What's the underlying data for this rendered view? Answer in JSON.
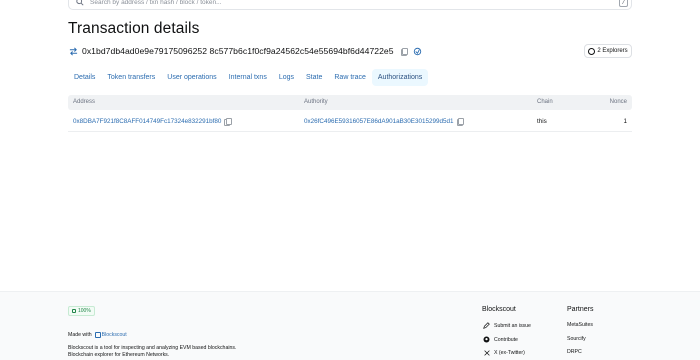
{
  "search": {
    "placeholder": "Search by address / txn hash / block / token...",
    "shortcut": "/"
  },
  "page": {
    "title": "Transaction details"
  },
  "tx": {
    "hash": "0x1bd7db4ad0e9e79175096252 8c577b6c1f0cf9a24562c54e55694bf6d44722e5"
  },
  "explorers": {
    "label": "2 Explorers"
  },
  "tabs": [
    {
      "label": "Details"
    },
    {
      "label": "Token transfers"
    },
    {
      "label": "User operations"
    },
    {
      "label": "Internal txns"
    },
    {
      "label": "Logs"
    },
    {
      "label": "State"
    },
    {
      "label": "Raw trace"
    },
    {
      "label": "Authorizations",
      "active": true
    }
  ],
  "table": {
    "headers": {
      "address": "Address",
      "authority": "Authority",
      "chain": "Chain",
      "nonce": "Nonce"
    },
    "rows": [
      {
        "address": "0x8DBA7F921f8C8AFF014749Fc17324e832291bf80",
        "authority": "0x26fC496E59316057E86dA901aB30E3015299d5d1",
        "chain": "this",
        "nonce": "1"
      }
    ]
  },
  "footer": {
    "zoom": "100%",
    "made_with": "Made with",
    "made_with_brand": "Blockscout",
    "description_line1": "Blockscout is a tool for inspecting and analyzing EVM based blockchains.",
    "description_line2": "Blockchain explorer for Ethereum Networks.",
    "col1_title": "Blockscout",
    "col1_links": [
      {
        "label": "Submit an issue",
        "icon": "edit-icon"
      },
      {
        "label": "Contribute",
        "icon": "github-icon"
      },
      {
        "label": "X (ex-Twitter)",
        "icon": "x-icon"
      }
    ],
    "col2_title": "Partners",
    "col2_links": [
      {
        "label": "MetaSuites"
      },
      {
        "label": "Sourcify"
      },
      {
        "label": "DRPC"
      }
    ]
  },
  "colors": {
    "link": "#2b6cb0",
    "active_tab_bg": "#ebf8ff",
    "header_bg": "#f0f2f4",
    "footer_bg": "#f9fafb"
  }
}
